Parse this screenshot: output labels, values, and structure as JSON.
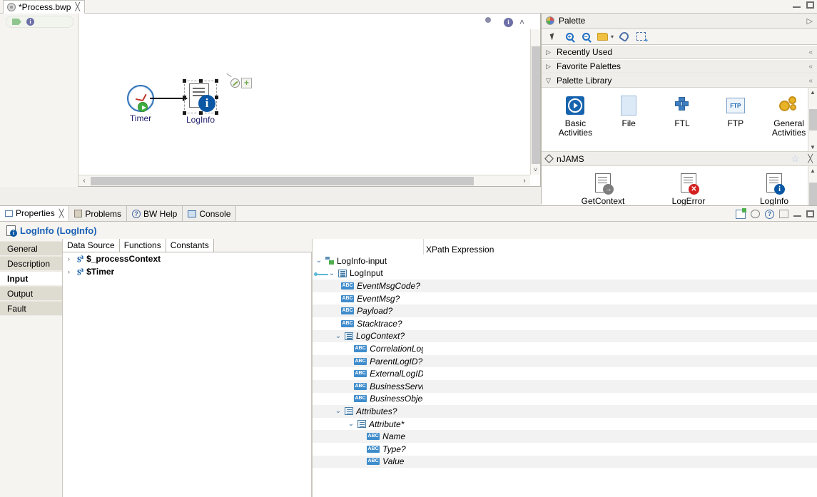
{
  "window": {
    "minimize_label": "minimize",
    "maximize_label": "maximize"
  },
  "editor": {
    "tab_title": "*Process.bwp",
    "tab_close": "╳",
    "breadcrumb_icon": "process-icon"
  },
  "canvas": {
    "toolbar": {
      "cloud_icon": "cloud-icon",
      "info_icon": "i",
      "collapse_icon": "˄"
    },
    "nodes": [
      {
        "id": "timer",
        "label": "Timer",
        "icon": "clock-icon",
        "badge": "play-badge"
      },
      {
        "id": "loginfo",
        "label": "LogInfo",
        "icon": "document-info-icon",
        "badge": "i",
        "selected": true
      }
    ],
    "mini_actions": {
      "wrench_label": "configure",
      "plus_label": "+"
    },
    "scroll_left": "‹",
    "scroll_right": "›",
    "scroll_down": "˅"
  },
  "palette": {
    "title": "Palette",
    "title_icon": "palette-icon",
    "expand_icon": "▷",
    "toolbar": [
      {
        "name": "select-tool",
        "icon": "cursor-icon"
      },
      {
        "name": "zoom-in-tool",
        "icon": "magnifier-plus-icon",
        "glyph": "+"
      },
      {
        "name": "zoom-out-tool",
        "icon": "magnifier-minus-icon",
        "glyph": "−"
      },
      {
        "name": "note-tool",
        "icon": "folder-icon"
      },
      {
        "name": "note-dropdown",
        "icon": "chevron-down-icon",
        "glyph": "▾"
      },
      {
        "name": "attachment-tool",
        "icon": "paperclip-icon"
      },
      {
        "name": "marquee-tool",
        "icon": "marquee-select-icon"
      }
    ],
    "sections": [
      {
        "label": "Recently Used",
        "expanded": false,
        "twisty": "▷",
        "right": "«"
      },
      {
        "label": "Favorite Palettes",
        "expanded": false,
        "twisty": "▷",
        "right": "«"
      },
      {
        "label": "Palette Library",
        "expanded": true,
        "twisty": "▽",
        "right": "«"
      }
    ],
    "library_items": [
      {
        "label": "Basic\nActivities",
        "label_line1": "Basic",
        "label_line2": "Activities",
        "icon": "basic-activities-icon"
      },
      {
        "label": "File",
        "label_line1": "File",
        "label_line2": "",
        "icon": "file-icon"
      },
      {
        "label": "FTL",
        "label_line1": "FTL",
        "label_line2": "",
        "icon": "ftl-icon"
      },
      {
        "label": "FTP",
        "label_line1": "FTP",
        "label_line2": "",
        "icon": "ftp-icon"
      },
      {
        "label": "General\nActivities",
        "label_line1": "General",
        "label_line2": "Activities",
        "icon": "general-activities-icon"
      }
    ],
    "njams": {
      "title": "nJAMS",
      "title_icon": "njams-diamond-icon",
      "favorite_icon": "star-icon",
      "close_icon": "╳",
      "items": [
        {
          "label": "GetContext",
          "icon": "getcontext-icon",
          "badge_color": "#7d7d7d",
          "badge_glyph": "→"
        },
        {
          "label": "LogError",
          "icon": "logerror-icon",
          "badge_color": "#d32020",
          "badge_glyph": "✕"
        },
        {
          "label": "LogInfo",
          "icon": "loginfo-icon",
          "badge_color": "#0b57a4",
          "badge_glyph": "i"
        }
      ],
      "items_row2": [
        {
          "label": "",
          "icon": "logdebug-icon",
          "badge_color": "#22b822",
          "badge_glyph": "✓"
        },
        {
          "label": "",
          "icon": "logwarn-icon",
          "badge_color": "#e8d320",
          "badge_glyph": "!"
        },
        {
          "label": "",
          "icon": "logmisc-icon",
          "badge_color": "#8d8d8d",
          "badge_glyph": "▲"
        }
      ],
      "scroll_up": "▲",
      "scroll_down": "▼"
    },
    "lib_scroll_up": "▲",
    "lib_scroll_down": "▼"
  },
  "properties": {
    "tabs": [
      {
        "label": "Properties",
        "icon": "properties-icon",
        "active": true,
        "close": "╳"
      },
      {
        "label": "Problems",
        "icon": "problems-icon",
        "active": false
      },
      {
        "label": "BW Help",
        "icon": "help-icon",
        "active": false
      },
      {
        "label": "Console",
        "icon": "console-icon",
        "active": false
      }
    ],
    "toolbar": [
      {
        "name": "restore-view-button",
        "icon": "restore-icon"
      },
      {
        "name": "link-with-editor-button",
        "icon": "link-icon"
      },
      {
        "name": "view-help-button",
        "icon": "question-icon",
        "glyph": "?"
      },
      {
        "name": "pin-view-button",
        "icon": "pin-icon"
      },
      {
        "name": "minimize-view-button",
        "icon": "minimize-icon"
      },
      {
        "name": "maximize-view-button",
        "icon": "maximize-icon"
      }
    ],
    "header_title": "LogInfo (LogInfo)",
    "header_icon": "loginfo-icon",
    "side_tabs": [
      {
        "label": "General",
        "active": false
      },
      {
        "label": "Description",
        "active": false
      },
      {
        "label": "Input",
        "active": true
      },
      {
        "label": "Output",
        "active": false
      },
      {
        "label": "Fault",
        "active": false
      }
    ],
    "data_source": {
      "tabs": [
        {
          "label": "Data Source",
          "active": true
        },
        {
          "label": "Functions",
          "active": false
        },
        {
          "label": "Constants",
          "active": false
        }
      ],
      "rows": [
        {
          "twisty": "›",
          "icon": "variable-icon",
          "label": "$_processContext"
        },
        {
          "twisty": "›",
          "icon": "variable-icon",
          "label": "$Timer"
        }
      ]
    },
    "xpath": {
      "column_header": "XPath Expression",
      "tree": [
        {
          "label": "LogInfo-input",
          "indent": 1,
          "twisty": "⌄",
          "icon": "schema-icon",
          "italic": false,
          "alt": false
        },
        {
          "label": "LogInput",
          "indent": 2,
          "twisty": "⌄",
          "icon": "element-icon",
          "italic": false,
          "alt": false,
          "connector": true
        },
        {
          "label": "EventMsgCode?",
          "indent": 3,
          "twisty": "",
          "icon": "abc-icon",
          "italic": true,
          "alt": true
        },
        {
          "label": "EventMsg?",
          "indent": 3,
          "twisty": "",
          "icon": "abc-icon",
          "italic": true,
          "alt": false
        },
        {
          "label": "Payload?",
          "indent": 3,
          "twisty": "",
          "icon": "abc-icon",
          "italic": true,
          "alt": true
        },
        {
          "label": "Stacktrace?",
          "indent": 3,
          "twisty": "",
          "icon": "abc-icon",
          "italic": true,
          "alt": false
        },
        {
          "label": "LogContext?",
          "indent": 3,
          "twisty": "⌄",
          "icon": "element-icon",
          "italic": true,
          "alt": true,
          "twisty_before": true
        },
        {
          "label": "CorrelationLogI",
          "indent": 4,
          "twisty": "",
          "icon": "abc-icon",
          "italic": true,
          "alt": false
        },
        {
          "label": "ParentLogID?",
          "indent": 4,
          "twisty": "",
          "icon": "abc-icon",
          "italic": true,
          "alt": true
        },
        {
          "label": "ExternalLogID?",
          "indent": 4,
          "twisty": "",
          "icon": "abc-icon",
          "italic": true,
          "alt": false
        },
        {
          "label": "BusinessService",
          "indent": 4,
          "twisty": "",
          "icon": "abc-icon",
          "italic": true,
          "alt": true
        },
        {
          "label": "BusinessObject",
          "indent": 4,
          "twisty": "",
          "icon": "abc-icon",
          "italic": true,
          "alt": false
        },
        {
          "label": "Attributes?",
          "indent": 3,
          "twisty": "⌄",
          "icon": "element-icon",
          "italic": true,
          "alt": true,
          "twisty_before": true
        },
        {
          "label": "Attribute*",
          "indent": 4,
          "twisty": "⌄",
          "icon": "element-icon",
          "italic": true,
          "alt": false,
          "twisty_before": true
        },
        {
          "label": "Name",
          "indent": 5,
          "twisty": "",
          "icon": "abc-icon",
          "italic": true,
          "alt": true
        },
        {
          "label": "Type?",
          "indent": 5,
          "twisty": "",
          "icon": "abc-icon",
          "italic": true,
          "alt": false
        },
        {
          "label": "Value",
          "indent": 5,
          "twisty": "",
          "icon": "abc-icon",
          "italic": true,
          "alt": true
        }
      ]
    }
  }
}
